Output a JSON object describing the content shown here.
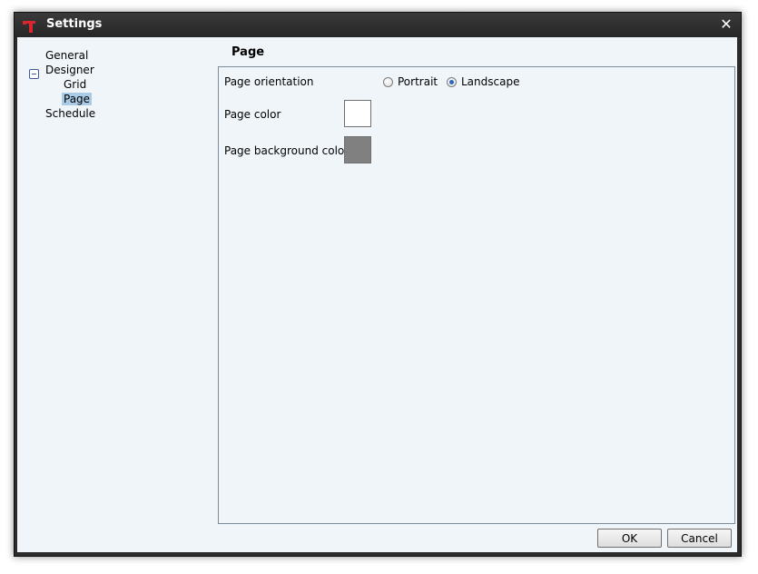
{
  "window": {
    "title": "Settings",
    "close_glyph": "✕",
    "app_icon": "app-logo-icon"
  },
  "tree": {
    "items": [
      {
        "label": "General"
      },
      {
        "label": "Designer",
        "expanded": true
      },
      {
        "label": "Grid"
      },
      {
        "label": "Page",
        "selected": true
      },
      {
        "label": "Schedule"
      }
    ]
  },
  "page": {
    "section_title": "Page",
    "orientation": {
      "label": "Page orientation",
      "options": [
        "Portrait",
        "Landscape"
      ],
      "selected": "Landscape"
    },
    "page_color": {
      "label": "Page color",
      "value": "#ffffff"
    },
    "page_background_color": {
      "label": "Page background color",
      "value": "#808080"
    }
  },
  "buttons": {
    "ok": "OK",
    "cancel": "Cancel"
  }
}
